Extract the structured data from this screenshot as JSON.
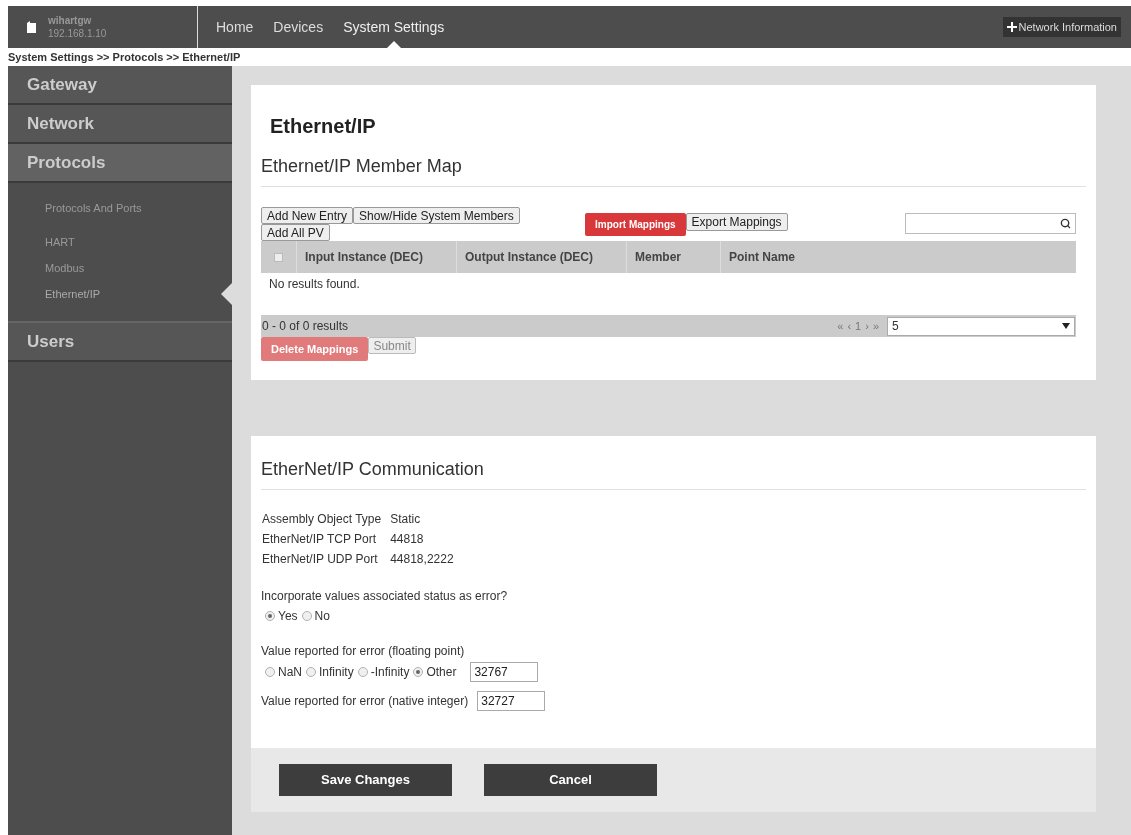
{
  "header": {
    "device_name": "wihartgw",
    "device_ip": "192.168.1.10",
    "nav": [
      {
        "label": "Home",
        "selected": false
      },
      {
        "label": "Devices",
        "selected": false
      },
      {
        "label": "System Settings",
        "selected": true
      }
    ],
    "network_info_button": "Network Information"
  },
  "breadcrumb": "System Settings >> Protocols >> Ethernet/IP",
  "sidebar": {
    "items": [
      {
        "label": "Gateway",
        "expanded": false
      },
      {
        "label": "Network",
        "expanded": false
      },
      {
        "label": "Protocols",
        "expanded": true,
        "children": [
          {
            "label": "Protocols And Ports",
            "selected": false
          },
          {
            "label": "HART",
            "selected": false
          },
          {
            "label": "Modbus",
            "selected": false
          },
          {
            "label": "Ethernet/IP",
            "selected": true
          }
        ]
      },
      {
        "label": "Users",
        "expanded": false
      }
    ]
  },
  "page_title": "Ethernet/IP",
  "member_map": {
    "title": "Ethernet/IP Member Map",
    "buttons": [
      "Add New Entry",
      "Show/Hide System Members",
      "Add All PV"
    ],
    "import_button": "Import Mappings",
    "export_button": "Export Mappings",
    "table": {
      "select_all_checked": false,
      "columns": [
        "Input Instance (DEC)",
        "Output Instance (DEC)",
        "Member",
        "Point Name"
      ],
      "empty_message": "No results found."
    },
    "pager": {
      "summary": "0 - 0 of 0 results",
      "controls": [
        "«",
        "‹",
        "1",
        "›",
        "»"
      ],
      "page_size": "5"
    },
    "delete_button": "Delete Mappings",
    "submit_button": "Submit"
  },
  "communication": {
    "title": "EtherNet/IP Communication",
    "info": [
      {
        "label": "Assembly Object Type",
        "value": "Static"
      },
      {
        "label": "EtherNet/IP TCP Port",
        "value": "44818"
      },
      {
        "label": "EtherNet/IP UDP Port",
        "value": "44818,2222"
      }
    ],
    "status_question": "Incorporate values associated status as error?",
    "status_options": [
      {
        "label": "Yes",
        "selected": true
      },
      {
        "label": "No",
        "selected": false
      }
    ],
    "float_label": "Value reported for error (floating point)",
    "float_options": [
      {
        "label": "NaN",
        "selected": false
      },
      {
        "label": "Infinity",
        "selected": false
      },
      {
        "label": "-Infinity",
        "selected": false
      },
      {
        "label": "Other",
        "selected": true
      }
    ],
    "float_value": "32767",
    "int_label": "Value reported for error (native integer)",
    "int_value": "32727"
  },
  "footer_buttons": [
    "Save Changes",
    "Cancel"
  ]
}
